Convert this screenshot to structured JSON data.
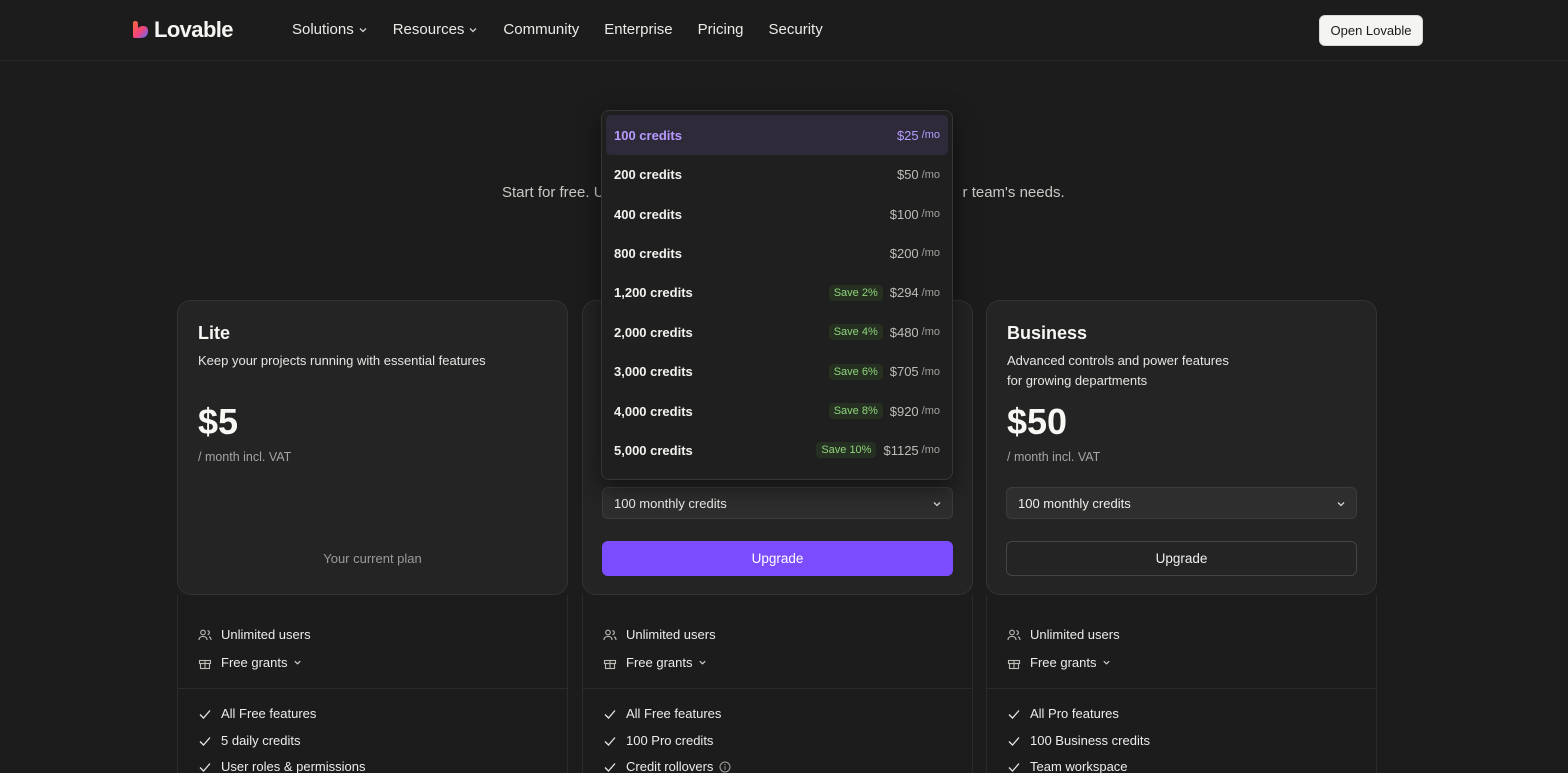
{
  "header": {
    "logo_text": "Lovable",
    "nav": [
      {
        "label": "Solutions",
        "has_menu": true
      },
      {
        "label": "Resources",
        "has_menu": true
      },
      {
        "label": "Community",
        "has_menu": false
      },
      {
        "label": "Enterprise",
        "has_menu": false
      },
      {
        "label": "Pricing",
        "has_menu": false
      },
      {
        "label": "Security",
        "has_menu": false
      }
    ],
    "cta_label": "Open Lovable"
  },
  "hero": {
    "subtitle_left": "Start for free. U",
    "subtitle_right": "r team's needs."
  },
  "plans": {
    "lite": {
      "title": "Lite",
      "description": "Keep your projects running with essential features",
      "price": "$5",
      "price_sub": "/ month incl. VAT",
      "current_label": "Your current plan",
      "features_top": [
        {
          "icon": "users-icon",
          "label": "Unlimited users"
        },
        {
          "icon": "gift-icon",
          "label": "Free grants"
        }
      ],
      "features": [
        "All Free features",
        "5 daily credits",
        "User roles & permissions"
      ]
    },
    "pro": {
      "select_value": "100 monthly credits",
      "upgrade_label": "Upgrade",
      "features_top": [
        {
          "icon": "users-icon",
          "label": "Unlimited users"
        },
        {
          "icon": "gift-icon",
          "label": "Free grants"
        }
      ],
      "features": [
        "All Free features",
        "100 Pro credits",
        "Credit rollovers"
      ]
    },
    "business": {
      "title": "Business",
      "description": "Advanced controls and power features for growing departments",
      "price": "$50",
      "price_sub": "/ month incl. VAT",
      "select_value": "100 monthly credits",
      "upgrade_label": "Upgrade",
      "features_top": [
        {
          "icon": "users-icon",
          "label": "Unlimited users"
        },
        {
          "icon": "gift-icon",
          "label": "Free grants"
        }
      ],
      "features": [
        "All Pro features",
        "100 Business credits",
        "Team workspace"
      ]
    }
  },
  "dropdown": {
    "per_label": "/mo",
    "options": [
      {
        "label": "100 credits",
        "save": "",
        "price": "$25",
        "selected": true
      },
      {
        "label": "200 credits",
        "save": "",
        "price": "$50",
        "selected": false
      },
      {
        "label": "400 credits",
        "save": "",
        "price": "$100",
        "selected": false
      },
      {
        "label": "800 credits",
        "save": "",
        "price": "$200",
        "selected": false
      },
      {
        "label": "1,200 credits",
        "save": "Save 2%",
        "price": "$294",
        "selected": false
      },
      {
        "label": "2,000 credits",
        "save": "Save 4%",
        "price": "$480",
        "selected": false
      },
      {
        "label": "3,000 credits",
        "save": "Save 6%",
        "price": "$705",
        "selected": false
      },
      {
        "label": "4,000 credits",
        "save": "Save 8%",
        "price": "$920",
        "selected": false
      },
      {
        "label": "5,000 credits",
        "save": "Save 10%",
        "price": "$1125",
        "selected": false
      }
    ]
  },
  "colors": {
    "background": "#1c1c1c",
    "accent": "#7c4dff",
    "selected_text": "#b69cff",
    "save_badge": "#8fd47a"
  }
}
